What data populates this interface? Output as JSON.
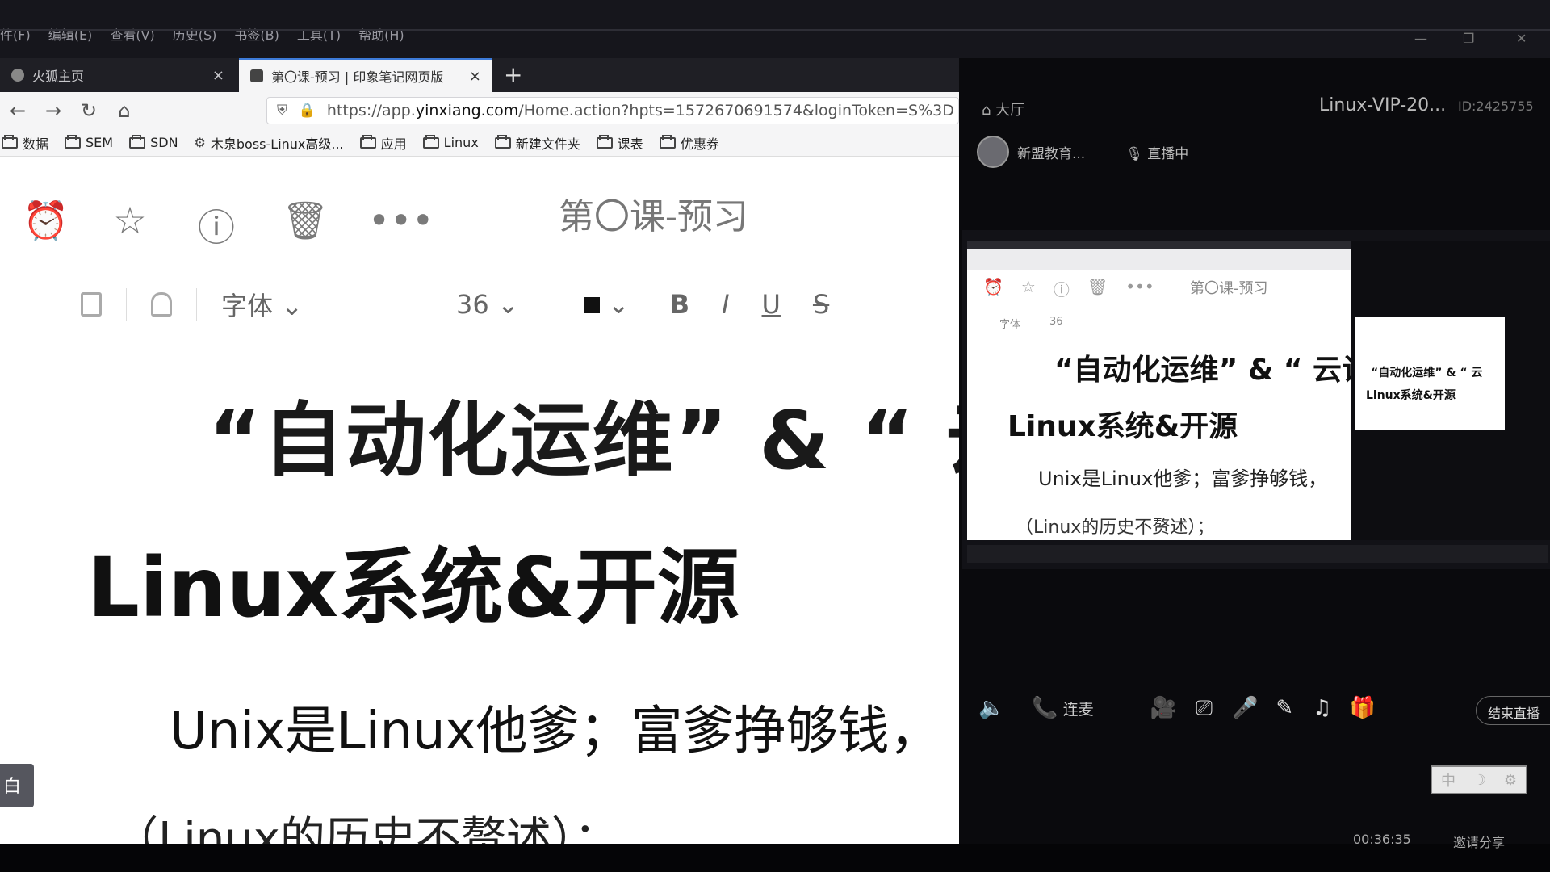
{
  "menubar": {
    "items": [
      "件(F)",
      "编辑(E)",
      "查看(V)",
      "历史(S)",
      "书签(B)",
      "工具(T)",
      "帮助(H)"
    ]
  },
  "tabs": [
    {
      "title": "火狐主页",
      "close": "×"
    },
    {
      "title": "第〇课-预习 | 印象笔记网页版",
      "close": "×"
    }
  ],
  "newtab": "+",
  "nav": {
    "back": "←",
    "forward": "→",
    "reload": "↻",
    "home": "⌂",
    "url_prefix": "https://app.",
    "url_host": "yinxiang.com",
    "url_rest": "/Home.action?hpts=1572670691574&loginToken=S%3D"
  },
  "bookmarks": [
    "数据",
    "SEM",
    "SDN",
    "木泉boss-Linux高级...",
    "应用",
    "Linux",
    "新建文件夹",
    "课表",
    "优惠券"
  ],
  "note": {
    "title": "第〇课-预习",
    "icons": {
      "alarm": "⏰",
      "star": "☆",
      "info": "ⓘ",
      "trash": "🗑",
      "more": "•••"
    },
    "font_label": "字体",
    "font_size": "36",
    "chevron": "⌄",
    "bold": "B",
    "italic": "I",
    "underline": "U",
    "strike": "S",
    "heading1": "“自动化运维” & “ 云计",
    "heading2": "Linux系统&开源",
    "para1": "Unix是Linux他爹；富爹挣够钱，",
    "para2": "（Linux的历史不赘述）；",
    "side_chip": "白"
  },
  "live": {
    "hall": "⌂ 大厅",
    "title": "Linux-VIP-20...",
    "id": "ID:2425755",
    "org": "新盟教育...",
    "status": "直播中",
    "thumb": {
      "title": "第〇课-预习",
      "font_label": "字体",
      "font_size": "36",
      "heading1": "“自动化运维” & “ 云计",
      "heading2": "Linux系统&开源",
      "para1": "Unix是Linux他爹；富爹挣够钱，",
      "para2": "（Linux的历史不赘述）；",
      "mini_h1": "“自动化运维” & “ 云",
      "mini_h2": "Linux系统&开源"
    },
    "controls": {
      "speaker": "🔈",
      "call": "📞",
      "call_label": "连麦",
      "camera": "🎥",
      "screen": "⎚",
      "mic": "🎤",
      "edit": "✎",
      "music": "♫",
      "gift": "🎁"
    },
    "end_button": "结束直播",
    "ime": [
      "中",
      "☽",
      "⚙"
    ],
    "timer": "00:36:35",
    "share": "邀请分享"
  }
}
